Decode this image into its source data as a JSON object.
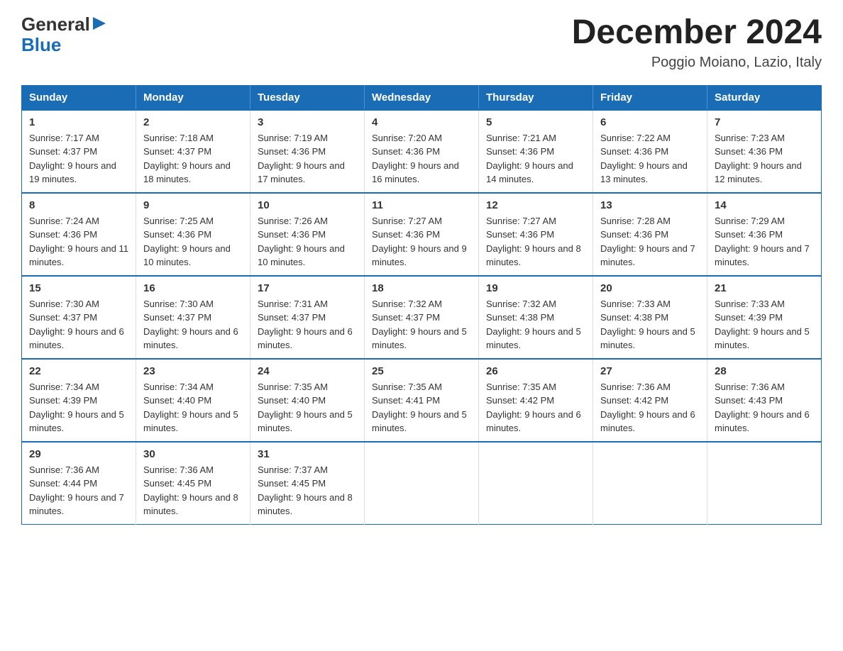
{
  "logo": {
    "general": "General",
    "blue": "Blue",
    "arrow": "▶"
  },
  "title": "December 2024",
  "subtitle": "Poggio Moiano, Lazio, Italy",
  "days_of_week": [
    "Sunday",
    "Monday",
    "Tuesday",
    "Wednesday",
    "Thursday",
    "Friday",
    "Saturday"
  ],
  "weeks": [
    [
      {
        "day": "1",
        "sunrise": "7:17 AM",
        "sunset": "4:37 PM",
        "daylight": "9 hours and 19 minutes."
      },
      {
        "day": "2",
        "sunrise": "7:18 AM",
        "sunset": "4:37 PM",
        "daylight": "9 hours and 18 minutes."
      },
      {
        "day": "3",
        "sunrise": "7:19 AM",
        "sunset": "4:36 PM",
        "daylight": "9 hours and 17 minutes."
      },
      {
        "day": "4",
        "sunrise": "7:20 AM",
        "sunset": "4:36 PM",
        "daylight": "9 hours and 16 minutes."
      },
      {
        "day": "5",
        "sunrise": "7:21 AM",
        "sunset": "4:36 PM",
        "daylight": "9 hours and 14 minutes."
      },
      {
        "day": "6",
        "sunrise": "7:22 AM",
        "sunset": "4:36 PM",
        "daylight": "9 hours and 13 minutes."
      },
      {
        "day": "7",
        "sunrise": "7:23 AM",
        "sunset": "4:36 PM",
        "daylight": "9 hours and 12 minutes."
      }
    ],
    [
      {
        "day": "8",
        "sunrise": "7:24 AM",
        "sunset": "4:36 PM",
        "daylight": "9 hours and 11 minutes."
      },
      {
        "day": "9",
        "sunrise": "7:25 AM",
        "sunset": "4:36 PM",
        "daylight": "9 hours and 10 minutes."
      },
      {
        "day": "10",
        "sunrise": "7:26 AM",
        "sunset": "4:36 PM",
        "daylight": "9 hours and 10 minutes."
      },
      {
        "day": "11",
        "sunrise": "7:27 AM",
        "sunset": "4:36 PM",
        "daylight": "9 hours and 9 minutes."
      },
      {
        "day": "12",
        "sunrise": "7:27 AM",
        "sunset": "4:36 PM",
        "daylight": "9 hours and 8 minutes."
      },
      {
        "day": "13",
        "sunrise": "7:28 AM",
        "sunset": "4:36 PM",
        "daylight": "9 hours and 7 minutes."
      },
      {
        "day": "14",
        "sunrise": "7:29 AM",
        "sunset": "4:36 PM",
        "daylight": "9 hours and 7 minutes."
      }
    ],
    [
      {
        "day": "15",
        "sunrise": "7:30 AM",
        "sunset": "4:37 PM",
        "daylight": "9 hours and 6 minutes."
      },
      {
        "day": "16",
        "sunrise": "7:30 AM",
        "sunset": "4:37 PM",
        "daylight": "9 hours and 6 minutes."
      },
      {
        "day": "17",
        "sunrise": "7:31 AM",
        "sunset": "4:37 PM",
        "daylight": "9 hours and 6 minutes."
      },
      {
        "day": "18",
        "sunrise": "7:32 AM",
        "sunset": "4:37 PM",
        "daylight": "9 hours and 5 minutes."
      },
      {
        "day": "19",
        "sunrise": "7:32 AM",
        "sunset": "4:38 PM",
        "daylight": "9 hours and 5 minutes."
      },
      {
        "day": "20",
        "sunrise": "7:33 AM",
        "sunset": "4:38 PM",
        "daylight": "9 hours and 5 minutes."
      },
      {
        "day": "21",
        "sunrise": "7:33 AM",
        "sunset": "4:39 PM",
        "daylight": "9 hours and 5 minutes."
      }
    ],
    [
      {
        "day": "22",
        "sunrise": "7:34 AM",
        "sunset": "4:39 PM",
        "daylight": "9 hours and 5 minutes."
      },
      {
        "day": "23",
        "sunrise": "7:34 AM",
        "sunset": "4:40 PM",
        "daylight": "9 hours and 5 minutes."
      },
      {
        "day": "24",
        "sunrise": "7:35 AM",
        "sunset": "4:40 PM",
        "daylight": "9 hours and 5 minutes."
      },
      {
        "day": "25",
        "sunrise": "7:35 AM",
        "sunset": "4:41 PM",
        "daylight": "9 hours and 5 minutes."
      },
      {
        "day": "26",
        "sunrise": "7:35 AM",
        "sunset": "4:42 PM",
        "daylight": "9 hours and 6 minutes."
      },
      {
        "day": "27",
        "sunrise": "7:36 AM",
        "sunset": "4:42 PM",
        "daylight": "9 hours and 6 minutes."
      },
      {
        "day": "28",
        "sunrise": "7:36 AM",
        "sunset": "4:43 PM",
        "daylight": "9 hours and 6 minutes."
      }
    ],
    [
      {
        "day": "29",
        "sunrise": "7:36 AM",
        "sunset": "4:44 PM",
        "daylight": "9 hours and 7 minutes."
      },
      {
        "day": "30",
        "sunrise": "7:36 AM",
        "sunset": "4:45 PM",
        "daylight": "9 hours and 8 minutes."
      },
      {
        "day": "31",
        "sunrise": "7:37 AM",
        "sunset": "4:45 PM",
        "daylight": "9 hours and 8 minutes."
      },
      null,
      null,
      null,
      null
    ]
  ],
  "labels": {
    "sunrise": "Sunrise:",
    "sunset": "Sunset:",
    "daylight": "Daylight:"
  }
}
